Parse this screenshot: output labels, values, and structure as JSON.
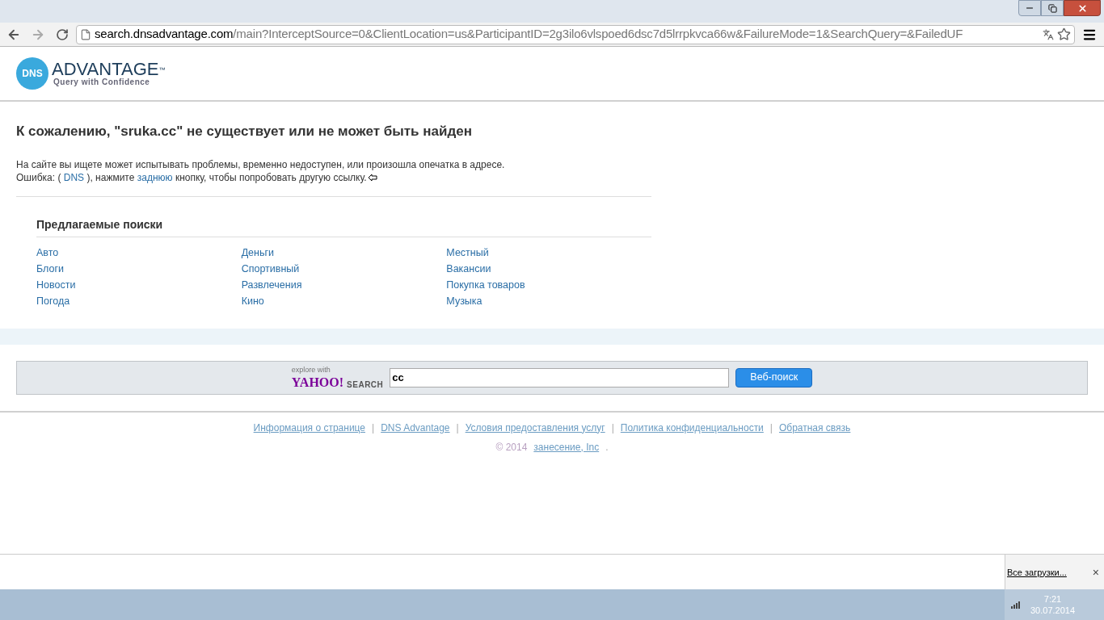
{
  "browser": {
    "url_host": "search.dnsadvantage.com",
    "url_rest": "/main?InterceptSource=0&ClientLocation=us&ParticipantID=2g3ilo6vlspoed6dsc7d5lrrpkvca66w&FailureMode=1&SearchQuery=&FailedUF"
  },
  "logo": {
    "badge": "DNS",
    "name": "ADVANTAGE",
    "tm": "™",
    "tagline": "Query with Confidence"
  },
  "heading": "К сожалению, \"sruka.cc\" не существует или не может быть найден",
  "message": "На сайте вы ищете может испытывать проблемы, временно недоступен, или произошла опечатка в адресе.",
  "error_line": [
    {
      "kind": "text",
      "text": "Ошибка: ( "
    },
    {
      "kind": "link",
      "text": "DNS"
    },
    {
      "kind": "text",
      "text": " ), нажмите "
    },
    {
      "kind": "link",
      "text": "заднюю"
    },
    {
      "kind": "text",
      "text": " кнопку, чтобы попробовать другую ссылку."
    }
  ],
  "suggestions": {
    "title": "Предлагаемые поиски",
    "columns": [
      [
        "Авто",
        "Блоги",
        "Новости",
        "Погода"
      ],
      [
        "Деньги",
        "Спортивный",
        "Развлечения",
        "Кино"
      ],
      [
        "Местный",
        "Вакансии",
        "Покупка товаров",
        "Музыка"
      ]
    ]
  },
  "search": {
    "explore": "explore with",
    "brand": "YAHOO!",
    "brand_suffix": "SEARCH",
    "value": "cc",
    "button": "Веб-поиск"
  },
  "footer": {
    "links": [
      {
        "kind": "link",
        "text": "Информация о странице"
      },
      {
        "kind": "separator",
        "text": "|"
      },
      {
        "kind": "link",
        "text": "DNS Advantage"
      },
      {
        "kind": "separator",
        "text": "|"
      },
      {
        "kind": "link",
        "text": "Условия предоставления услуг"
      },
      {
        "kind": "separator",
        "text": "|"
      },
      {
        "kind": "link",
        "text": "Политика конфиденциальности"
      },
      {
        "kind": "separator",
        "text": "|"
      },
      {
        "kind": "link",
        "text": "Обратная связь"
      }
    ],
    "copyright": "© 2014",
    "company": "занесение, Inc",
    "end": "."
  },
  "downloads": {
    "link": "Все загрузки...",
    "close": "×"
  },
  "taskbar": {
    "time": "7:21",
    "date": "30.07.2014"
  }
}
